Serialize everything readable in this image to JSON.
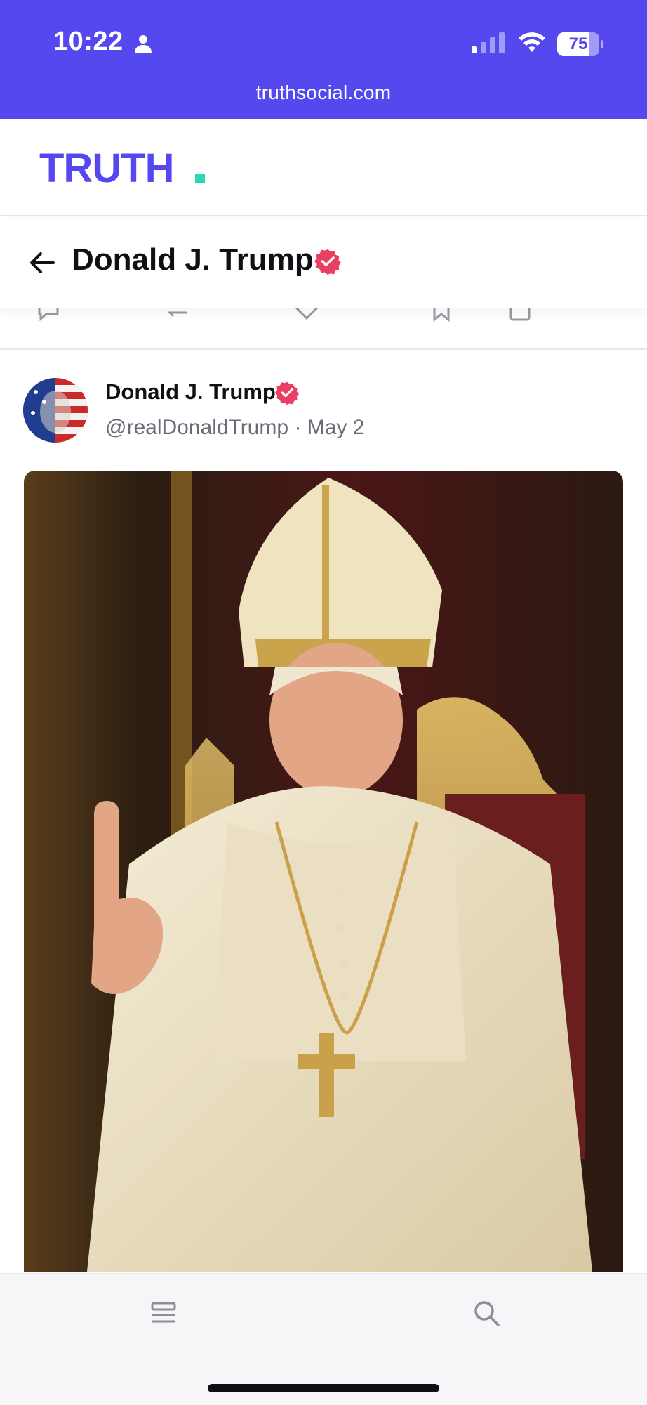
{
  "status_bar": {
    "time": "10:22",
    "battery_level": "75",
    "battery_fraction": 0.75,
    "signal_bars_active": 1,
    "url": "truthsocial.com"
  },
  "header": {
    "logo_text": "TRUTH"
  },
  "profile_bar": {
    "title": "Donald J. Trump",
    "verified": true
  },
  "post": {
    "author_name": "Donald J. Trump",
    "handle": "@realDonaldTrump",
    "date": "May 2",
    "handle_line": "@realDonaldTrump · May 2",
    "verified": true
  },
  "bottom_nav": {
    "items": [
      "feed-icon",
      "search-icon"
    ]
  },
  "colors": {
    "brand": "#5448ee",
    "logo_dot": "#2ad6b4",
    "verified": "#ea3e63"
  }
}
